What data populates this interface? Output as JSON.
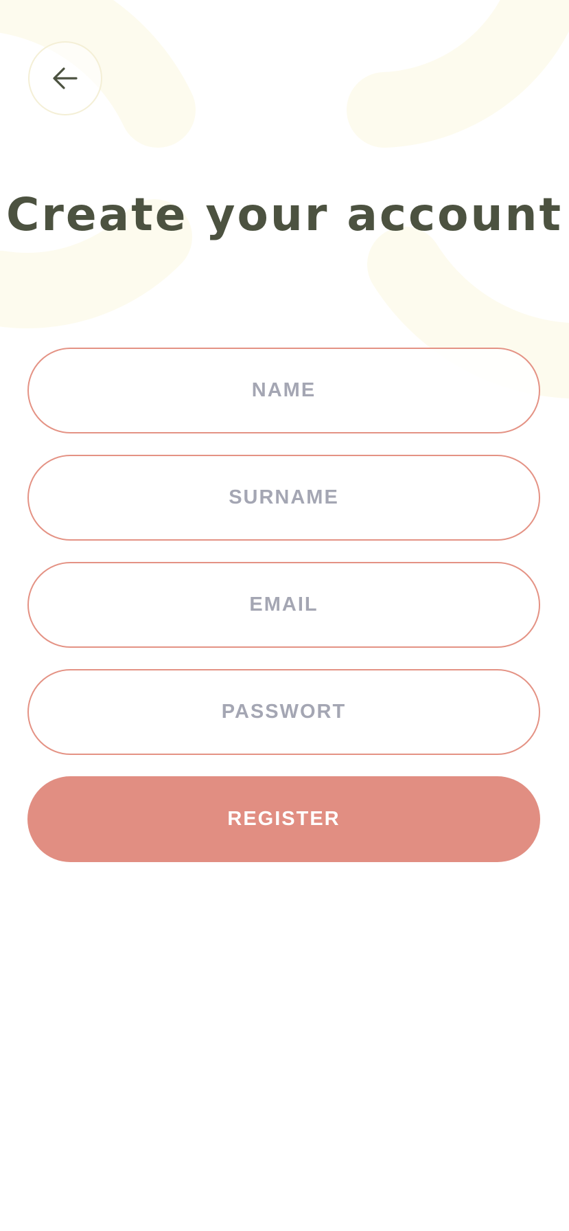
{
  "header": {
    "back_icon": "arrow-left-icon",
    "title": "Create your account"
  },
  "form": {
    "fields": [
      {
        "name": "name",
        "placeholder": "NAME",
        "value": ""
      },
      {
        "name": "surname",
        "placeholder": "SURNAME",
        "value": ""
      },
      {
        "name": "email",
        "placeholder": "EMAIL",
        "value": ""
      },
      {
        "name": "password",
        "placeholder": "PASSWORT",
        "value": ""
      }
    ],
    "submit_label": "REGISTER"
  },
  "colors": {
    "title": "#4c5240",
    "accent": "#e18e82",
    "field_border": "#e49284",
    "placeholder": "#a4a6b3",
    "decoration": "#fdfbee"
  }
}
